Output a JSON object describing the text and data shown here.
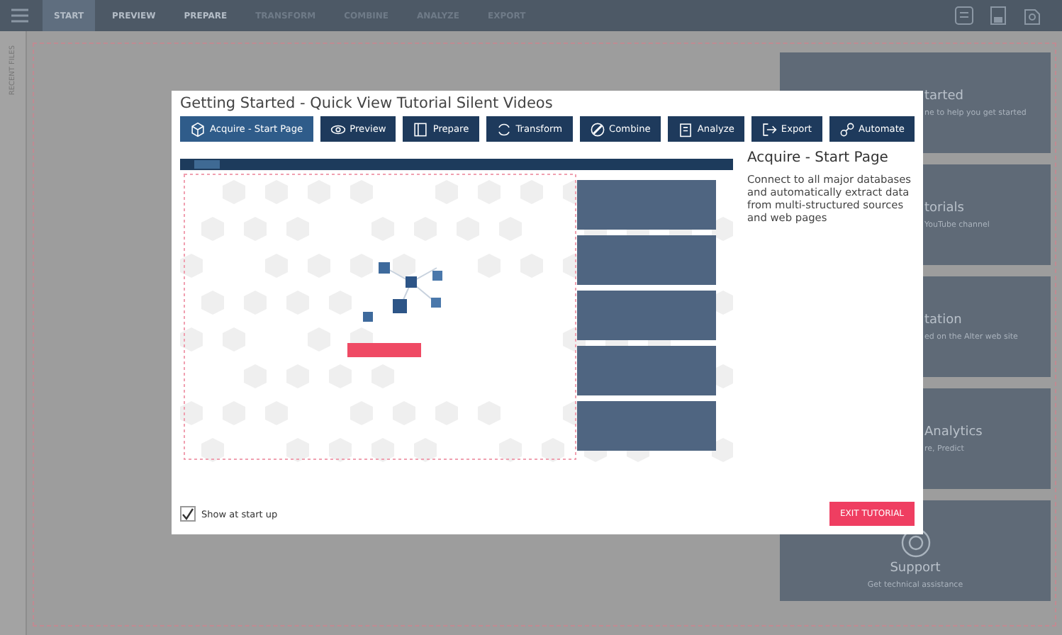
{
  "app_toolbar": {
    "tabs": [
      {
        "label": "START",
        "selected": true,
        "disabled": false
      },
      {
        "label": "PREVIEW",
        "selected": false,
        "disabled": false
      },
      {
        "label": "PREPARE",
        "selected": false,
        "disabled": false
      },
      {
        "label": "TRANSFORM",
        "selected": false,
        "disabled": true
      },
      {
        "label": "COMBINE",
        "selected": false,
        "disabled": true
      },
      {
        "label": "ANALYZE",
        "selected": false,
        "disabled": true
      },
      {
        "label": "EXPORT",
        "selected": false,
        "disabled": true
      }
    ]
  },
  "side_panel": {
    "label": "RECENT FILES"
  },
  "start_cards": [
    {
      "title": "tarted",
      "subtitle": "ne to help you get started",
      "kind": "covered"
    },
    {
      "title": "torials",
      "subtitle": "YouTube channel",
      "kind": "covered"
    },
    {
      "title": "tation",
      "subtitle": "ed on the Alter web site",
      "kind": "covered"
    },
    {
      "title": "Analytics",
      "subtitle": "re, Predict",
      "kind": "covered"
    },
    {
      "title": "Support",
      "subtitle": "Get technical assistance",
      "kind": "support"
    }
  ],
  "dialog": {
    "title": "Getting Started - Quick View Tutorial Silent Videos",
    "steps": [
      {
        "label": "Acquire - Start Page",
        "selected": true
      },
      {
        "label": "Preview",
        "selected": false
      },
      {
        "label": "Prepare",
        "selected": false
      },
      {
        "label": "Transform",
        "selected": false
      },
      {
        "label": "Combine",
        "selected": false
      },
      {
        "label": "Analyze",
        "selected": false
      },
      {
        "label": "Export",
        "selected": false
      },
      {
        "label": "Automate",
        "selected": false
      }
    ],
    "heading": "Acquire - Start Page",
    "description": "Connect to all major databases and automatically extract data from multi-structured sources and web pages",
    "show_at_startup": {
      "label": "Show at start up",
      "checked": true
    },
    "exit_button": "EXIT TUTORIAL"
  }
}
